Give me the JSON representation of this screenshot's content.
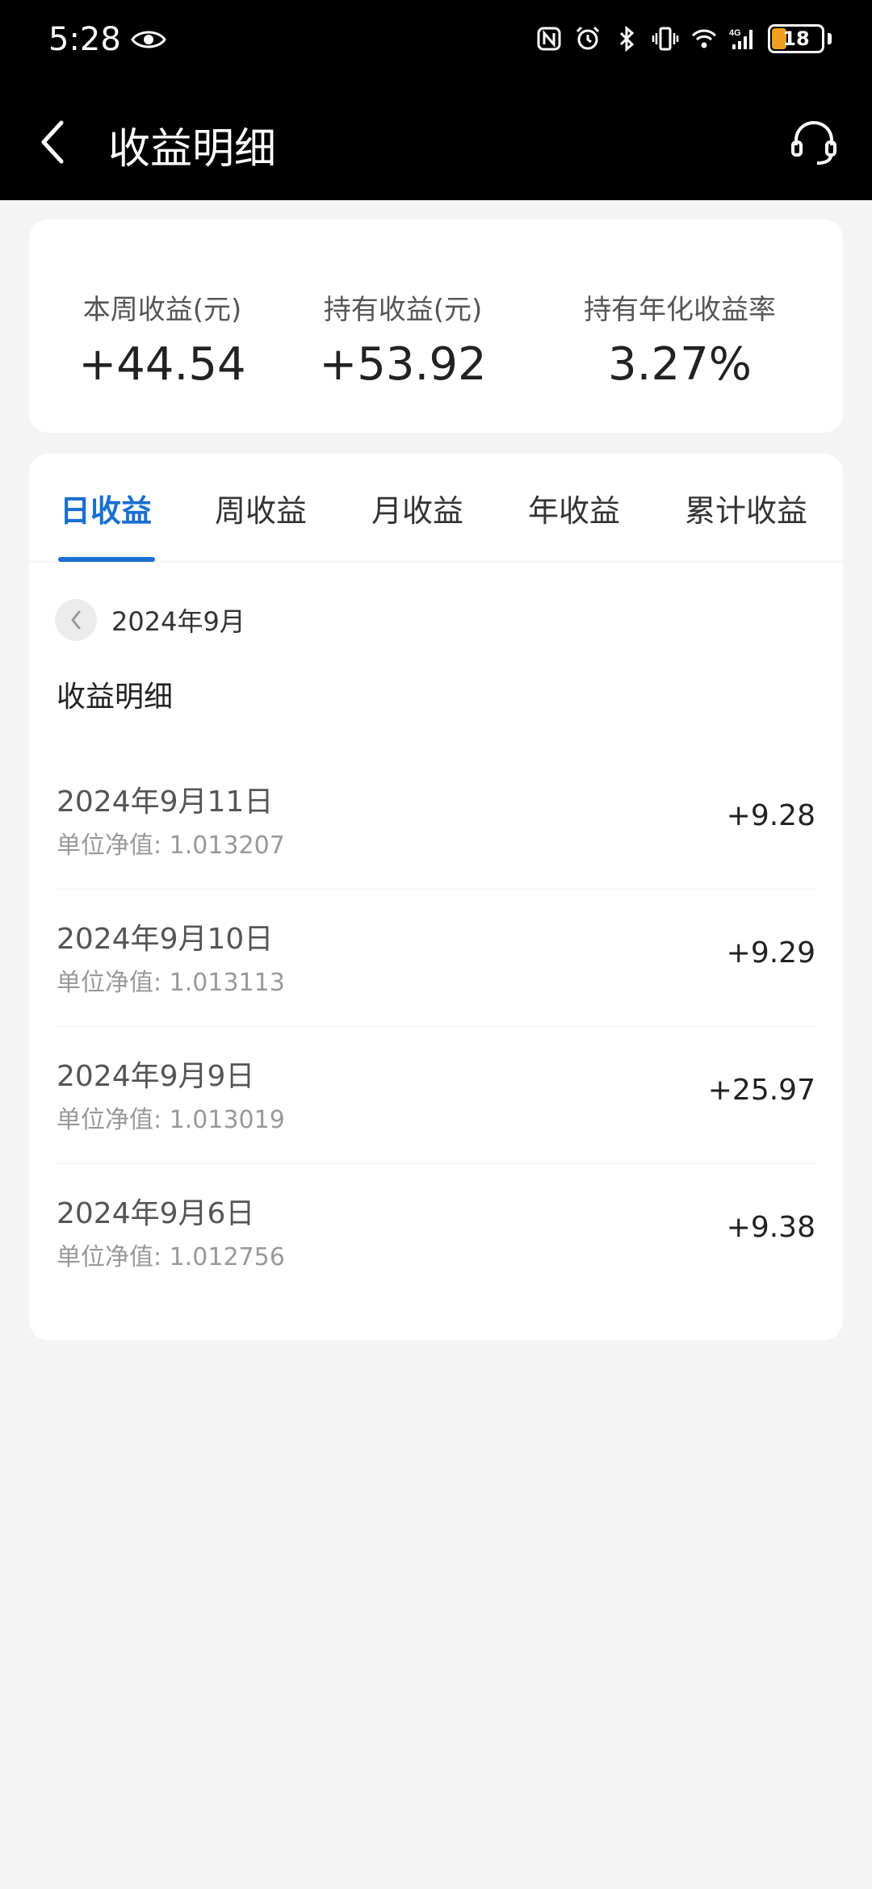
{
  "status_bar": {
    "time": "5:28",
    "battery": "18",
    "icons": [
      "eye-icon",
      "nfc-icon",
      "alarm-icon",
      "bluetooth-icon",
      "vibrate-icon",
      "wifi-icon",
      "signal-4g-icon",
      "battery-icon"
    ]
  },
  "nav": {
    "title": "收益明细",
    "back_icon": "chevron-left-icon",
    "support_icon": "headset-icon"
  },
  "summary": {
    "weekly_label": "本周收益(元)",
    "weekly_value": "+44.54",
    "holding_label": "持有收益(元)",
    "holding_value": "+53.92",
    "annual_label": "持有年化收益率",
    "annual_value": "3.27%"
  },
  "tabs": [
    {
      "label": "日收益",
      "active": true
    },
    {
      "label": "周收益",
      "active": false
    },
    {
      "label": "月收益",
      "active": false
    },
    {
      "label": "年收益",
      "active": false
    },
    {
      "label": "累计收益",
      "active": false
    }
  ],
  "month": "2024年9月",
  "section_title": "收益明细",
  "rows": [
    {
      "date": "2024年9月11日",
      "nav": "单位净值: 1.013207",
      "amount": "+9.28"
    },
    {
      "date": "2024年9月10日",
      "nav": "单位净值: 1.013113",
      "amount": "+9.29"
    },
    {
      "date": "2024年9月9日",
      "nav": "单位净值: 1.013019",
      "amount": "+25.97"
    },
    {
      "date": "2024年9月6日",
      "nav": "单位净值: 1.012756",
      "amount": "+9.38"
    }
  ],
  "colors": {
    "accent": "#1a6fd0",
    "header_bg": "#000000",
    "page_bg": "#f4f4f4",
    "battery_low": "#f0a020"
  }
}
